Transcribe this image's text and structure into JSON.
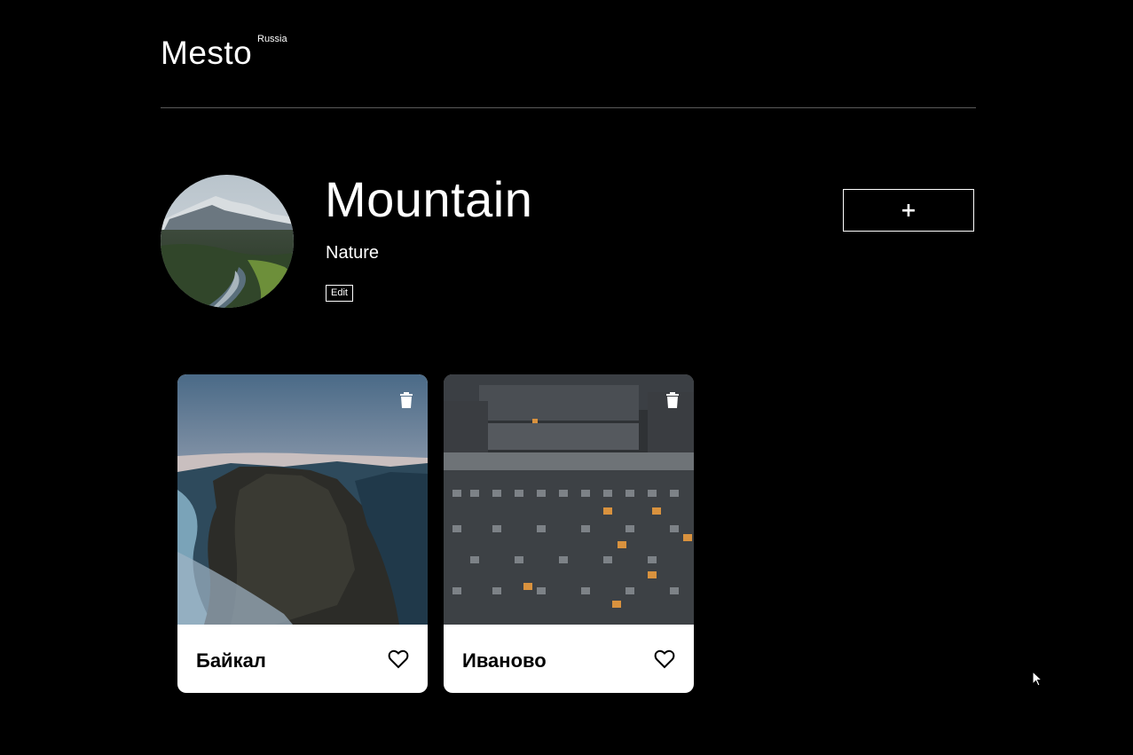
{
  "header": {
    "logo": "Mesto",
    "logo_sub": "Russia"
  },
  "profile": {
    "name": "Mountain",
    "about": "Nature",
    "edit_label": "Edit",
    "add_label": "+"
  },
  "cards": [
    {
      "title": "Байкал",
      "image": "rocky-lake-shore-photo"
    },
    {
      "title": "Иваново",
      "image": "apartment-blocks-photo"
    }
  ],
  "icons": {
    "like": "heart-icon",
    "delete": "trash-icon",
    "cursor": "mouse-pointer"
  },
  "colors": {
    "background": "#000000",
    "text": "#ffffff",
    "card_background": "#ffffff",
    "card_text": "#000000"
  }
}
